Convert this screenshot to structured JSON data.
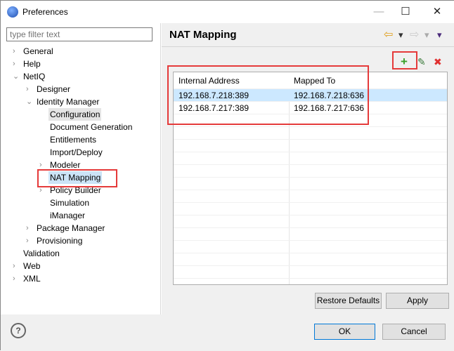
{
  "window": {
    "title": "Preferences",
    "minimize": "—",
    "maximize": "☐",
    "close": "✕"
  },
  "filter": {
    "placeholder": "type filter text"
  },
  "tree": [
    {
      "label": "General",
      "level": 0,
      "chevron": "›"
    },
    {
      "label": "Help",
      "level": 0,
      "chevron": "›"
    },
    {
      "label": "NetIQ",
      "level": 0,
      "chevron": "⌄"
    },
    {
      "label": "Designer",
      "level": 1,
      "chevron": "›"
    },
    {
      "label": "Identity Manager",
      "level": 1,
      "chevron": "⌄"
    },
    {
      "label": "Configuration",
      "level": 2,
      "chevron": ""
    },
    {
      "label": "Document Generation",
      "level": 2,
      "chevron": ""
    },
    {
      "label": "Entitlements",
      "level": 2,
      "chevron": ""
    },
    {
      "label": "Import/Deploy",
      "level": 2,
      "chevron": ""
    },
    {
      "label": "Modeler",
      "level": 2,
      "chevron": "›"
    },
    {
      "label": "NAT Mapping",
      "level": 2,
      "chevron": ""
    },
    {
      "label": "Policy Builder",
      "level": 2,
      "chevron": "›"
    },
    {
      "label": "Simulation",
      "level": 2,
      "chevron": ""
    },
    {
      "label": "iManager",
      "level": 2,
      "chevron": ""
    },
    {
      "label": "Package Manager",
      "level": 1,
      "chevron": "›"
    },
    {
      "label": "Provisioning",
      "level": 1,
      "chevron": "›"
    },
    {
      "label": "Validation",
      "level": 0,
      "chevron": ""
    },
    {
      "label": "Web",
      "level": 0,
      "chevron": "›"
    },
    {
      "label": "XML",
      "level": 0,
      "chevron": "›"
    }
  ],
  "page": {
    "title": "NAT Mapping"
  },
  "table": {
    "columns": [
      "Internal Address",
      "Mapped To"
    ],
    "rows": [
      [
        "192.168.7.218:389",
        "192.168.7.218:636"
      ],
      [
        "192.168.7.217:389",
        "192.168.7.217:636"
      ]
    ]
  },
  "buttons": {
    "restore": "Restore Defaults",
    "apply": "Apply",
    "ok": "OK",
    "cancel": "Cancel",
    "help": "?"
  },
  "icons": {
    "add": "+",
    "edit": "✎",
    "delete": "✖",
    "back": "⇦",
    "forward": "⇨",
    "dropdown": "▾"
  }
}
